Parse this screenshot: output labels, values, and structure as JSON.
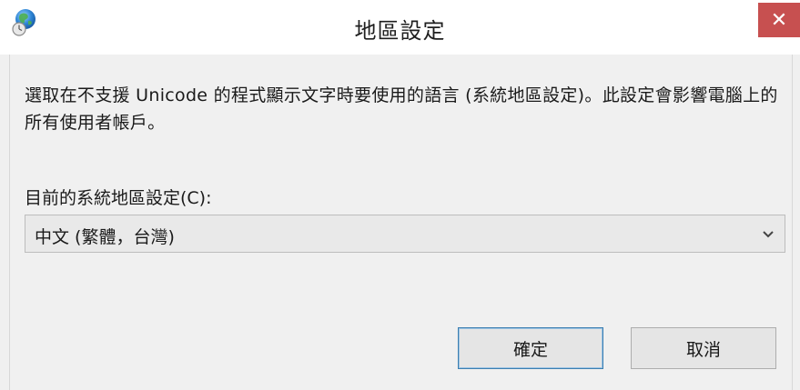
{
  "window": {
    "title": "地區設定",
    "close_glyph": "✕",
    "icon": "globe-clock-icon"
  },
  "body": {
    "description": "選取在不支援 Unicode 的程式顯示文字時要使用的語言 (系統地區設定)。此設定會影響電腦上的所有使用者帳戶。",
    "current_locale_label": "目前的系統地區設定(C):",
    "current_locale_value": "中文 (繁體，台灣)"
  },
  "buttons": {
    "ok_label": "確定",
    "cancel_label": "取消"
  },
  "colors": {
    "close_button": "#c75050",
    "ok_border": "#3c7fb1"
  }
}
